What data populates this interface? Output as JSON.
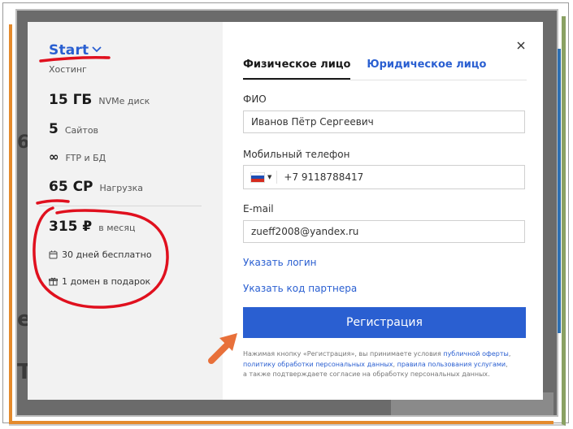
{
  "plan": {
    "name": "Start",
    "type": "Хостинг",
    "specs": [
      {
        "value": "15 ГБ",
        "label": "NVMe диск"
      },
      {
        "value": "5",
        "label": "Сайтов"
      },
      {
        "value": "∞",
        "label": "FTP и БД"
      },
      {
        "value": "65 CP",
        "label": "Нагрузка"
      }
    ],
    "price": {
      "value": "315 ₽",
      "label": "в месяц"
    },
    "features": [
      {
        "icon": "calendar-icon",
        "text": "30 дней бесплатно"
      },
      {
        "icon": "gift-icon",
        "text": "1 домен в подарок"
      }
    ]
  },
  "form": {
    "tabs": [
      "Физическое лицо",
      "Юридическое лицо"
    ],
    "fio": {
      "label": "ФИО",
      "value": "Иванов Пётр Сергеевич"
    },
    "phone": {
      "label": "Мобильный телефон",
      "value": "+7 9118788417",
      "country_icon": "russia-flag-icon"
    },
    "email": {
      "label": "E-mail",
      "value": "zueff2008@yandex.ru"
    },
    "login_link": "Указать логин",
    "partner_link": "Указать код партнера",
    "submit_label": "Регистрация",
    "disclaimer": {
      "prefix": "Нажимая кнопку «Регистрация», вы принимаете условия ",
      "offer_link": "публичной оферты",
      "sep1": ",",
      "privacy_link": "политику обработки персональных данных",
      "sep2": ", ",
      "rules_link": "правила пользования услугами",
      "sep3": ",",
      "suffix": "а также подтверждаете согласие на обработку персональных данных."
    }
  },
  "colors": {
    "accent": "#2a5fd1",
    "annotation": "#e0101e",
    "arrow": "#e8703a"
  }
}
